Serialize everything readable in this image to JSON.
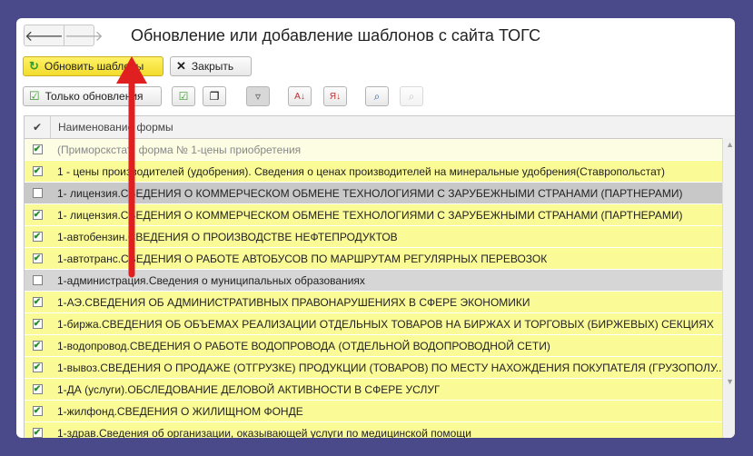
{
  "window": {
    "title": "Обновление или добавление шаблонов с сайта ТОГС",
    "nav_back": "🡐",
    "nav_forward": "🡒"
  },
  "toolbar": {
    "update_label": "Обновить шаблоны",
    "close_label": "Закрыть",
    "only_updates_label": "Только обновления"
  },
  "grid": {
    "header_check": "✔",
    "header_name": "Наименование формы",
    "rows": [
      {
        "text": "(Приморскстат) форма № 1-цены приобретения",
        "checked": true,
        "style": "pale"
      },
      {
        "text": "1 - цены производителей (удобрения). Сведения о ценах производителей на  минеральные удобрения(Ставропольстат)",
        "checked": true,
        "style": "yellow"
      },
      {
        "text": "1- лицензия.СВЕДЕНИЯ О КОММЕРЧЕСКОМ ОБМЕНЕ ТЕХНОЛОГИЯМИ С ЗАРУБЕЖНЫМИ СТРАНАМИ (ПАРТНЕРАМИ)",
        "checked": false,
        "style": "gray"
      },
      {
        "text": "1- лицензия.СВЕДЕНИЯ О КОММЕРЧЕСКОМ ОБМЕНЕ ТЕХНОЛОГИЯМИ С ЗАРУБЕЖНЫМИ СТРАНАМИ (ПАРТНЕРАМИ)",
        "checked": true,
        "style": "yellow"
      },
      {
        "text": "1-автобензин.СВЕДЕНИЯ О ПРОИЗВОДСТВЕ НЕФТЕПРОДУКТОВ",
        "checked": true,
        "style": "yellow"
      },
      {
        "text": "1-автотранс.СВЕДЕНИЯ О РАБОТЕ АВТОБУСОВ ПО МАРШРУТАМ РЕГУЛЯРНЫХ ПЕРЕВОЗОК",
        "checked": true,
        "style": "yellow"
      },
      {
        "text": "1-администрация.Сведения о муниципальных образованиях",
        "checked": false,
        "style": "gray2"
      },
      {
        "text": "1-АЭ.СВЕДЕНИЯ ОБ АДМИНИСТРАТИВНЫХ ПРАВОНАРУШЕНИЯХ В СФЕРЕ ЭКОНОМИКИ",
        "checked": true,
        "style": "yellow"
      },
      {
        "text": "1-биржа.СВЕДЕНИЯ ОБ ОБЪЕМАХ РЕАЛИЗАЦИИ ОТДЕЛЬНЫХ ТОВАРОВ НА БИРЖАХ И ТОРГОВЫХ (БИРЖЕВЫХ) СЕКЦИЯХ",
        "checked": true,
        "style": "yellow"
      },
      {
        "text": "1-водопровод.СВЕДЕНИЯ О РАБОТЕ ВОДОПРОВОДА (ОТДЕЛЬНОЙ ВОДОПРОВОДНОЙ СЕТИ)",
        "checked": true,
        "style": "yellow"
      },
      {
        "text": "1-вывоз.СВЕДЕНИЯ О ПРОДАЖЕ (ОТГРУЗКЕ) ПРОДУКЦИИ (ТОВАРОВ) ПО МЕСТУ НАХОЖДЕНИЯ ПОКУПАТЕЛЯ (ГРУЗОПОЛУ...",
        "checked": true,
        "style": "yellow"
      },
      {
        "text": "1-ДА (услуги).ОБСЛЕДОВАНИЕ ДЕЛОВОЙ АКТИВНОСТИ В СФЕРЕ УСЛУГ",
        "checked": true,
        "style": "yellow"
      },
      {
        "text": "1-жилфонд.СВЕДЕНИЯ О ЖИЛИЩНОМ ФОНДЕ",
        "checked": true,
        "style": "yellow"
      },
      {
        "text": "1-здрав.Сведения об организации, оказывающей услуги по медицинской помощи",
        "checked": true,
        "style": "yellow"
      }
    ]
  },
  "colors": {
    "accent_yellow": "#f2dc2c",
    "row_yellow": "#fafa96",
    "row_gray": "#c8c8c8",
    "arrow_red": "#e02020",
    "background": "#4a4a8a"
  }
}
